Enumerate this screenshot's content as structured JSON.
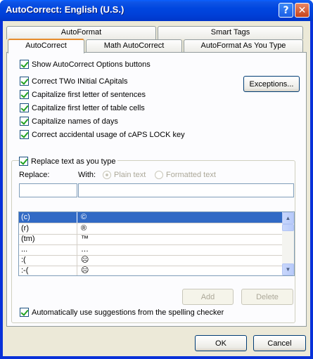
{
  "window": {
    "title": "AutoCorrect: English (U.S.)",
    "help_glyph": "?",
    "close_glyph": "✕"
  },
  "tabs": {
    "row_back": [
      "AutoFormat",
      "Smart Tags"
    ],
    "row_front": [
      "AutoCorrect",
      "Math AutoCorrect",
      "AutoFormat As You Type"
    ],
    "active": "AutoCorrect"
  },
  "options": {
    "show_buttons": {
      "label": "Show AutoCorrect Options buttons",
      "checked": true
    },
    "two_initial": {
      "label": "Correct TWo INitial CApitals",
      "checked": true
    },
    "first_sentence": {
      "label": "Capitalize first letter of sentences",
      "checked": true
    },
    "first_table": {
      "label": "Capitalize first letter of table cells",
      "checked": true
    },
    "names_days": {
      "label": "Capitalize names of days",
      "checked": true
    },
    "caps_lock": {
      "label": "Correct accidental usage of cAPS LOCK key",
      "checked": true
    },
    "exceptions_button": "Exceptions..."
  },
  "replace": {
    "checkbox_label": "Replace text as you type",
    "checked": true,
    "replace_label": "Replace:",
    "with_label": "With:",
    "plain_text": "Plain text",
    "formatted_text": "Formatted text",
    "replace_value": "",
    "with_value": ""
  },
  "list": {
    "rows": [
      {
        "from": "(c)",
        "to": "©"
      },
      {
        "from": "(r)",
        "to": "®"
      },
      {
        "from": "(tm)",
        "to": "™"
      },
      {
        "from": "...",
        "to": "…"
      },
      {
        "from": ":(",
        "to": "☹"
      },
      {
        "from": ":-(",
        "to": "☹"
      }
    ],
    "selected_index": 0
  },
  "actions": {
    "add": "Add",
    "delete": "Delete",
    "suggestions_label": "Automatically use suggestions from the spelling checker",
    "suggestions_checked": true
  },
  "footer": {
    "ok": "OK",
    "cancel": "Cancel"
  },
  "colors": {
    "titlebar": "#0046df",
    "dialog_bg": "#ece9d8",
    "selection": "#316ac5",
    "tab_accent": "#e68b2c"
  }
}
